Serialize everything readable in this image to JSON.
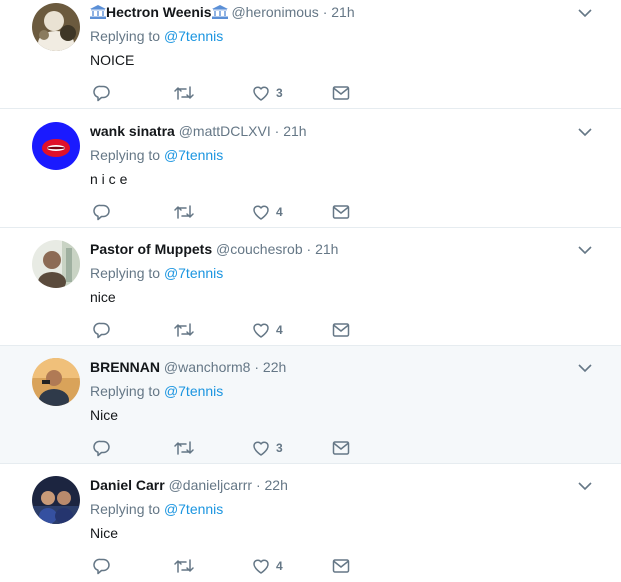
{
  "reply_prefix": "Replying to",
  "icon_color": "#657786",
  "tweets": [
    {
      "name": "Hectron Weenis",
      "name_emoji": "bank-icon",
      "handle": "@heronimous",
      "dot": "·",
      "time": "21h",
      "reply_to": "@7tennis",
      "text": "NOICE",
      "likes": "3"
    },
    {
      "name": "wank sinatra",
      "handle": "@mattDCLXVI",
      "dot": "·",
      "time": "21h",
      "reply_to": "@7tennis",
      "text": "n i c e",
      "likes": "4"
    },
    {
      "name": "Pastor of Muppets",
      "handle": "@couchesrob",
      "dot": "·",
      "time": "21h",
      "reply_to": "@7tennis",
      "text": "nice",
      "likes": "4"
    },
    {
      "name": "BRENNAN",
      "handle": "@wanchorm8",
      "dot": "·",
      "time": "22h",
      "reply_to": "@7tennis",
      "text": "Nice",
      "likes": "3"
    },
    {
      "name": "Daniel Carr",
      "handle": "@danieljcarrr",
      "dot": "·",
      "time": "22h",
      "reply_to": "@7tennis",
      "text": "Nice",
      "likes": "4"
    }
  ]
}
